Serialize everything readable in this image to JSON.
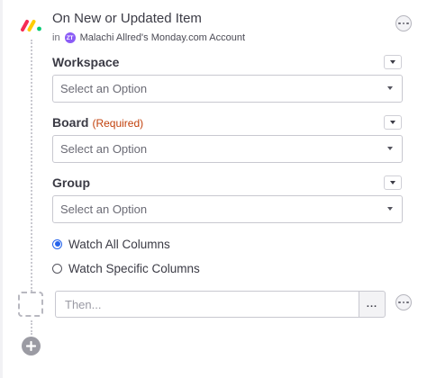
{
  "trigger": {
    "title": "On New or Updated Item",
    "account_prefix": "in",
    "account_badge": "ZT",
    "account_name": "Malachi Allred's Monday.com Account",
    "logo_icon": "monday-logo-icon",
    "logo_colors": [
      "#f62b54",
      "#ffcc00",
      "#00ca72"
    ]
  },
  "fields": [
    {
      "label": "Workspace",
      "required_text": "",
      "placeholder": "Select an Option"
    },
    {
      "label": "Board",
      "required_text": "(Required)",
      "placeholder": "Select an Option"
    },
    {
      "label": "Group",
      "required_text": "",
      "placeholder": "Select an Option"
    }
  ],
  "watch_options": [
    {
      "label": "Watch All Columns",
      "checked": true
    },
    {
      "label": "Watch Specific Columns",
      "checked": false
    }
  ],
  "then_step": {
    "placeholder": "Then...",
    "button_label": "..."
  },
  "colors": {
    "accent": "#2563eb",
    "required": "#c2410c",
    "account_badge": "#8b5cf6"
  }
}
